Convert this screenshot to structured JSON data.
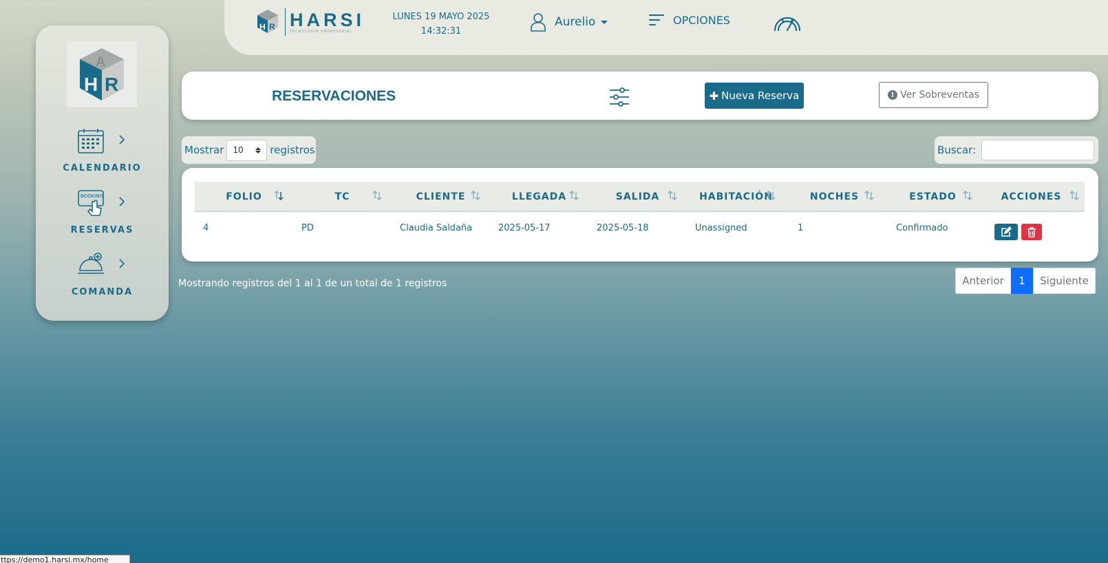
{
  "header": {
    "brand_name": "HARSI",
    "brand_tagline": "TECNOLOGÍA EMPRESARIAL",
    "date": "LUNES 19 MAYO 2025",
    "time": "14:32:31",
    "user_name": "Aurelio",
    "options_label": "OPCIONES",
    "icons": [
      "user-icon",
      "menu-lines-icon",
      "speedometer-icon"
    ]
  },
  "sidebar": {
    "items": [
      {
        "label": "CALENDARIO",
        "icon": "calendar-icon"
      },
      {
        "label": "RESERVAS",
        "icon": "booking-hand-icon"
      },
      {
        "label": "COMANDA",
        "icon": "service-bell-icon"
      }
    ]
  },
  "page": {
    "title": "RESERVACIONES",
    "new_button": "Nueva Reserva",
    "overbooking_button": "Ver Sobreventas"
  },
  "table_controls": {
    "show_label": "Mostrar",
    "page_size": "10",
    "records_label": "registros",
    "search_label": "Buscar:",
    "search_value": ""
  },
  "table": {
    "columns": [
      "FOLIO",
      "TC",
      "CLIENTE",
      "LLEGADA",
      "SALIDA",
      "HABITACIÓN",
      "NOCHES",
      "ESTADO",
      "ACCIONES"
    ],
    "rows": [
      {
        "folio": "4",
        "tc": "PD",
        "cliente": "Claudia Saldaña",
        "llegada": "2025-05-17",
        "salida": "2025-05-18",
        "habitacion": "Unassigned",
        "noches": "1",
        "estado": "Confirmado"
      }
    ]
  },
  "footer": {
    "info": "Mostrando registros del 1 al 1 de un total de 1 registros",
    "prev": "Anterior",
    "current_page": "1",
    "next": "Siguiente"
  },
  "statusbar": {
    "url": "ttps://demo1.harsi.mx/home"
  },
  "colors": {
    "primary": "#1a6a8a",
    "danger": "#dc3545",
    "pager_active": "#0d6efd"
  }
}
